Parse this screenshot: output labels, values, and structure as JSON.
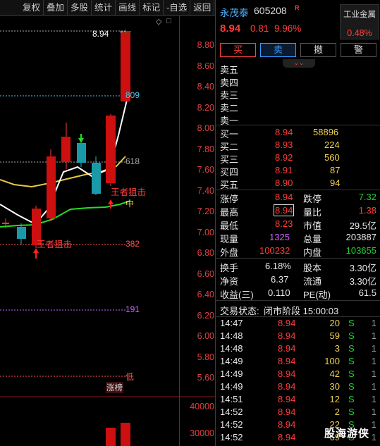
{
  "toolbar": {
    "items": [
      "复权",
      "叠加",
      "多股",
      "统计",
      "画线",
      "标记",
      "-自选",
      "返回"
    ]
  },
  "chart": {
    "price_axis": [
      "8.80",
      "8.60",
      "8.40",
      "8.20",
      "8.00",
      "7.80",
      "7.60",
      "7.40",
      "7.20",
      "7.00",
      "6.80",
      "6.60",
      "6.40",
      "6.20",
      "6.00",
      "5.80",
      "5.60"
    ],
    "volume_axis": [
      "40000",
      "30000"
    ],
    "high_label": "8.94",
    "fib_levels": [
      "809",
      "618",
      "382",
      "191"
    ],
    "low_marker": "低",
    "zt_label": "涨榜",
    "annotation1": "王者狙击",
    "annotation2": "王者狙击",
    "zhong_label": "中",
    "corner_icons": [
      "◇",
      "□"
    ]
  },
  "quote": {
    "name": "永茂泰",
    "code": "605208",
    "r_badge": "R",
    "price": "8.94",
    "change": "0.81",
    "change_pct": "9.96%",
    "industry_name": "工业金属",
    "industry_pct": "0.48%"
  },
  "trade_buttons": {
    "buy": "买",
    "sell": "卖",
    "cancel": "撤",
    "alert": "警"
  },
  "sell_book": [
    "卖五",
    "卖四",
    "卖三",
    "卖二",
    "卖一"
  ],
  "buy_book": [
    {
      "label": "买一",
      "price": "8.94",
      "vol": "58896"
    },
    {
      "label": "买二",
      "price": "8.93",
      "vol": "224"
    },
    {
      "label": "买三",
      "price": "8.92",
      "vol": "560"
    },
    {
      "label": "买四",
      "price": "8.91",
      "vol": "87"
    },
    {
      "label": "买五",
      "price": "8.90",
      "vol": "94"
    }
  ],
  "stats": {
    "zt_label": "涨停",
    "zt_val": "8.94",
    "dt_label": "跌停",
    "dt_val": "7.32",
    "high_label": "最高",
    "high_val": "8.94",
    "lb_label": "量比",
    "lb_val": "1.38",
    "low_label": "最低",
    "low_val": "8.23",
    "sz_label": "市值",
    "sz_val": "29.5亿",
    "xl_label": "现量",
    "xl_val": "1325",
    "zl_label": "总量",
    "zl_val": "203887",
    "wp_label": "外盘",
    "wp_val": "100232",
    "np_label": "内盘",
    "np_val": "103655"
  },
  "fund": {
    "hs_label": "换手",
    "hs_val": "6.18%",
    "gb_label": "股本",
    "gb_val": "3.30亿",
    "jz_label": "净资",
    "jz_val": "6.37",
    "lt_label": "流通",
    "lt_val": "3.30亿",
    "sy_label": "收益(三)",
    "sy_val": "0.110",
    "pe_label": "PE(动)",
    "pe_val": "61.5"
  },
  "status": {
    "label": "交易状态:",
    "value": "闭市阶段 15:00:03"
  },
  "ticks": [
    {
      "time": "14:47",
      "price": "8.94",
      "vol": "20",
      "side": "S",
      "n": "1"
    },
    {
      "time": "14:48",
      "price": "8.94",
      "vol": "59",
      "side": "S",
      "n": "1"
    },
    {
      "time": "14:48",
      "price": "8.94",
      "vol": "3",
      "side": "S",
      "n": "1"
    },
    {
      "time": "14:49",
      "price": "8.94",
      "vol": "100",
      "side": "S",
      "n": "1"
    },
    {
      "time": "14:49",
      "price": "8.94",
      "vol": "42",
      "side": "S",
      "n": "1"
    },
    {
      "time": "14:49",
      "price": "8.94",
      "vol": "30",
      "side": "S",
      "n": "1"
    },
    {
      "time": "14:51",
      "price": "8.94",
      "vol": "12",
      "side": "S",
      "n": "1"
    },
    {
      "time": "14:52",
      "price": "8.94",
      "vol": "2",
      "side": "S",
      "n": "1"
    },
    {
      "time": "14:52",
      "price": "8.94",
      "vol": "22",
      "side": "S",
      "n": "1"
    },
    {
      "time": "14:52",
      "price": "8.94",
      "vol": "69",
      "side": "S",
      "n": "1"
    }
  ],
  "watermark": "股海游侠",
  "colors": {
    "up": "#ff3c3c",
    "down": "#22cc33",
    "accent": "#4fb3ff"
  }
}
